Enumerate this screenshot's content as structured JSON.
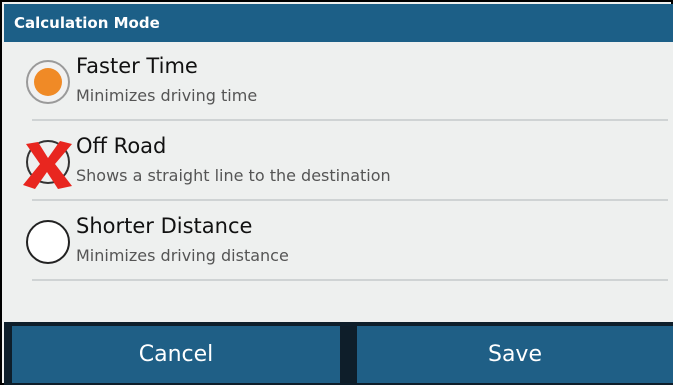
{
  "dialog": {
    "title": "Calculation Mode"
  },
  "options": [
    {
      "title": "Faster Time",
      "description": "Minimizes driving time",
      "selected": true,
      "icon": "radio-selected-icon"
    },
    {
      "title": "Off Road",
      "description": "Shows a straight line to the destination",
      "selected": false,
      "icon": "radio-icon",
      "overlay_icon": "red-x-icon"
    },
    {
      "title": "Shorter Distance",
      "description": "Minimizes driving distance",
      "selected": false,
      "icon": "radio-icon"
    }
  ],
  "buttons": {
    "cancel_label": "Cancel",
    "save_label": "Save"
  },
  "colors": {
    "title_bar": "#1c5f87",
    "button": "#1f5f86",
    "accent": "#f08a26",
    "x_mark": "#e8261f",
    "background": "#eef0ef"
  }
}
